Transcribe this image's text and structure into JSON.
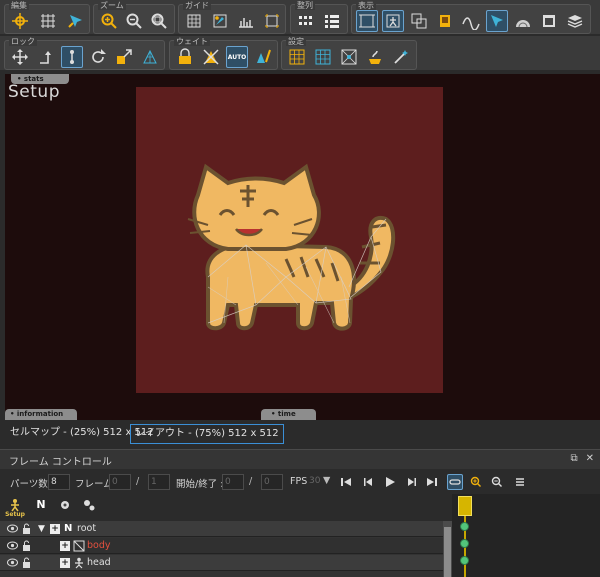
{
  "toolbar": {
    "groups": {
      "edit": "編集",
      "zoom": "ズーム",
      "guide": "ガイド",
      "align": "整列",
      "display": "表示",
      "lock": "ロック",
      "weight": "ウェイト",
      "setting": "設定"
    },
    "auto_label": "AUTO"
  },
  "viewport": {
    "stats_tab": "• stats",
    "setup_title": "Setup",
    "information_tab": "• information",
    "time_tab": "• time",
    "canvas_color": "#5d1e1e",
    "background_color": "#1d0c0c"
  },
  "view_tabs": [
    {
      "label": "セルマップ - (25%) 512 x 512",
      "active": false
    },
    {
      "label": "レイアウト - (75%) 512 x 512",
      "active": true
    }
  ],
  "frame_control": {
    "title": "フレーム コントロール",
    "parts_count_label": "パーツ数 :",
    "parts_count_value": "8",
    "frame_label": "フレーム :",
    "frame_value": "0",
    "frame_total": "1",
    "separator": "/",
    "start_end_label": "開始/終了 :",
    "start_value": "0",
    "end_value": "0",
    "fps_label": "FPS",
    "fps_value": "30"
  },
  "parts_tools": {
    "setup_label": "Setup",
    "null_label": "N"
  },
  "parts": [
    {
      "name": "root",
      "color": "#e0e0e0",
      "kind": "null-part"
    },
    {
      "name": "body",
      "color": "#e3503e",
      "kind": "mesh-part"
    },
    {
      "name": "head",
      "color": "#e0e0e0",
      "kind": "bone-part"
    }
  ],
  "colors": {
    "accent": "#3b8fd6",
    "timeline_marker": "#d6b500",
    "keyframe": "#53c47b"
  }
}
